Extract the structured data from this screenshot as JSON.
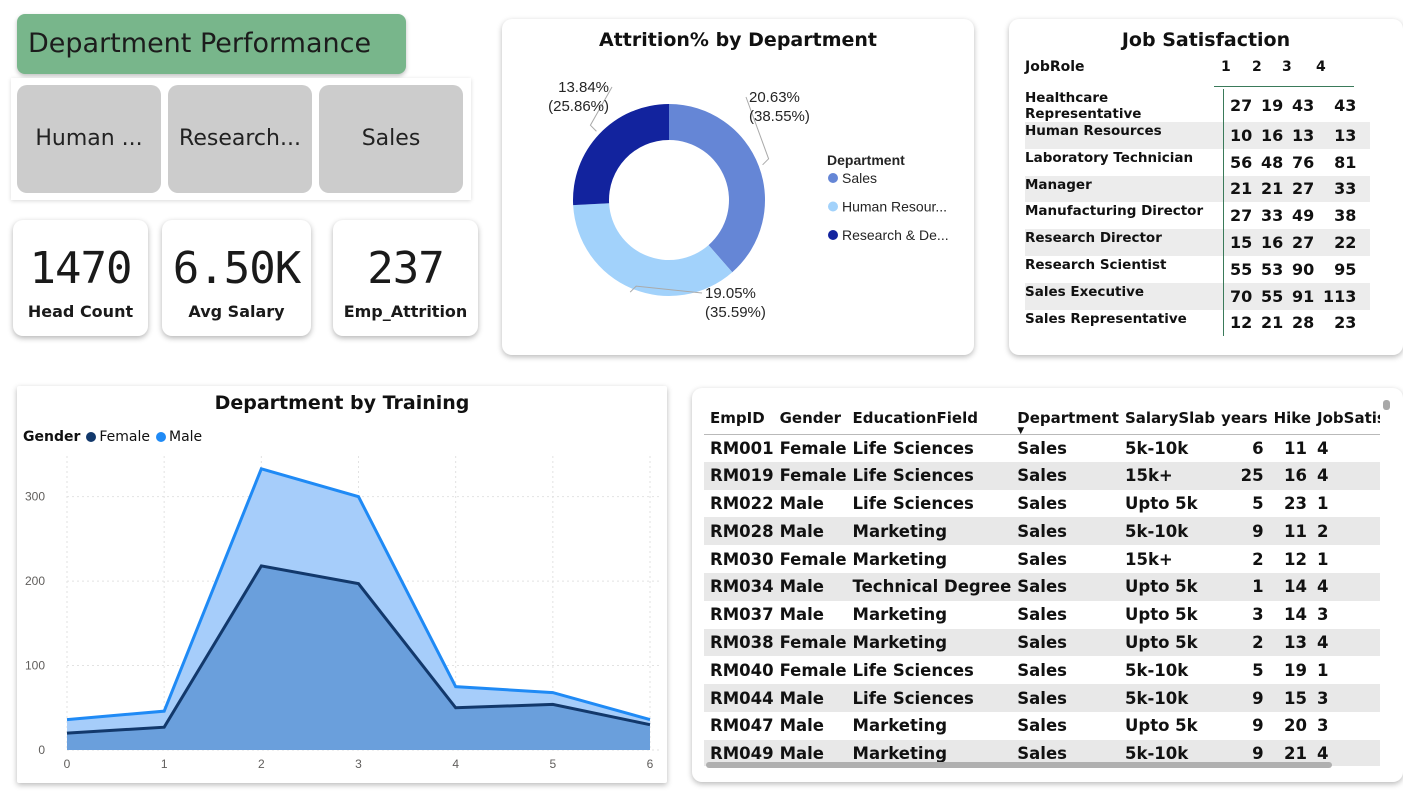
{
  "title": "Department Performance",
  "slicer": {
    "items": [
      "Human ...",
      "Research...",
      "Sales"
    ]
  },
  "kpis": [
    {
      "value": "1470",
      "label": "Head Count"
    },
    {
      "value": "6.50K",
      "label": "Avg Salary"
    },
    {
      "value": "237",
      "label": "Emp_Attrition"
    }
  ],
  "donut": {
    "title": "Attrition% by Department",
    "legend_title": "Department",
    "slices": [
      {
        "name": "Sales",
        "legend_label": "Sales",
        "pct": 38.55,
        "label1": "20.63%",
        "label2": "(38.55%)",
        "color": "#6586d6"
      },
      {
        "name": "Human Resources",
        "legend_label": "Human Resour...",
        "pct": 35.59,
        "label1": "19.05%",
        "label2": "(35.59%)",
        "color": "#a2d2fb"
      },
      {
        "name": "Research & Development",
        "legend_label": "Research & De...",
        "pct": 25.86,
        "label1": "13.84%",
        "label2": "(25.86%)",
        "color": "#12239e"
      }
    ]
  },
  "job_satisfaction": {
    "title": "Job Satisfaction",
    "role_header": "JobRole",
    "levels": [
      "1",
      "2",
      "3",
      "4"
    ],
    "rows": [
      {
        "role": "Healthcare Representative",
        "v": [
          "27",
          "19",
          "43",
          "43"
        ]
      },
      {
        "role": "Human Resources",
        "v": [
          "10",
          "16",
          "13",
          "13"
        ]
      },
      {
        "role": "Laboratory Technician",
        "v": [
          "56",
          "48",
          "76",
          "81"
        ]
      },
      {
        "role": "Manager",
        "v": [
          "21",
          "21",
          "27",
          "33"
        ]
      },
      {
        "role": "Manufacturing Director",
        "v": [
          "27",
          "33",
          "49",
          "38"
        ]
      },
      {
        "role": "Research Director",
        "v": [
          "15",
          "16",
          "27",
          "22"
        ]
      },
      {
        "role": "Research Scientist",
        "v": [
          "55",
          "53",
          "90",
          "95"
        ]
      },
      {
        "role": "Sales Executive",
        "v": [
          "70",
          "55",
          "91",
          "113"
        ]
      },
      {
        "role": "Sales Representative",
        "v": [
          "12",
          "21",
          "28",
          "23"
        ]
      }
    ]
  },
  "area": {
    "title": "Department by Training",
    "legend_title": "Gender",
    "legend": [
      {
        "name": "Female",
        "color": "#12386b"
      },
      {
        "name": "Male",
        "color": "#1f8af5"
      }
    ]
  },
  "chart_data": {
    "type": "area",
    "title": "Department by Training",
    "xlabel": "",
    "ylabel": "",
    "x": [
      0,
      1,
      2,
      3,
      4,
      5,
      6
    ],
    "series": [
      {
        "name": "Female",
        "values": [
          20,
          27,
          218,
          197,
          50,
          54,
          30
        ]
      },
      {
        "name": "Male",
        "values": [
          36,
          46,
          333,
          300,
          75,
          68,
          36
        ]
      }
    ],
    "ylim": [
      0,
      360
    ],
    "yticks": [
      0,
      100,
      200,
      300
    ],
    "grid": true,
    "legend": "top-left"
  },
  "employees": {
    "headers": [
      "EmpID",
      "Gender",
      "EducationField",
      "Department",
      "SalarySlab",
      "years",
      "Hike",
      "JobSatisf"
    ],
    "rows": [
      [
        "RM001",
        "Female",
        "Life Sciences",
        "Sales",
        "5k-10k",
        "6",
        "11",
        "4"
      ],
      [
        "RM019",
        "Female",
        "Life Sciences",
        "Sales",
        "15k+",
        "25",
        "16",
        "4"
      ],
      [
        "RM022",
        "Male",
        "Life Sciences",
        "Sales",
        "Upto 5k",
        "5",
        "23",
        "1"
      ],
      [
        "RM028",
        "Male",
        "Marketing",
        "Sales",
        "5k-10k",
        "9",
        "11",
        "2"
      ],
      [
        "RM030",
        "Female",
        "Marketing",
        "Sales",
        "15k+",
        "2",
        "12",
        "1"
      ],
      [
        "RM034",
        "Male",
        "Technical Degree",
        "Sales",
        "Upto 5k",
        "1",
        "14",
        "4"
      ],
      [
        "RM037",
        "Male",
        "Marketing",
        "Sales",
        "Upto 5k",
        "3",
        "14",
        "3"
      ],
      [
        "RM038",
        "Female",
        "Marketing",
        "Sales",
        "Upto 5k",
        "2",
        "13",
        "4"
      ],
      [
        "RM040",
        "Female",
        "Life Sciences",
        "Sales",
        "5k-10k",
        "5",
        "19",
        "1"
      ],
      [
        "RM044",
        "Male",
        "Life Sciences",
        "Sales",
        "5k-10k",
        "9",
        "15",
        "3"
      ],
      [
        "RM047",
        "Male",
        "Marketing",
        "Sales",
        "Upto 5k",
        "9",
        "20",
        "3"
      ],
      [
        "RM049",
        "Male",
        "Marketing",
        "Sales",
        "5k-10k",
        "9",
        "21",
        "4"
      ]
    ]
  }
}
